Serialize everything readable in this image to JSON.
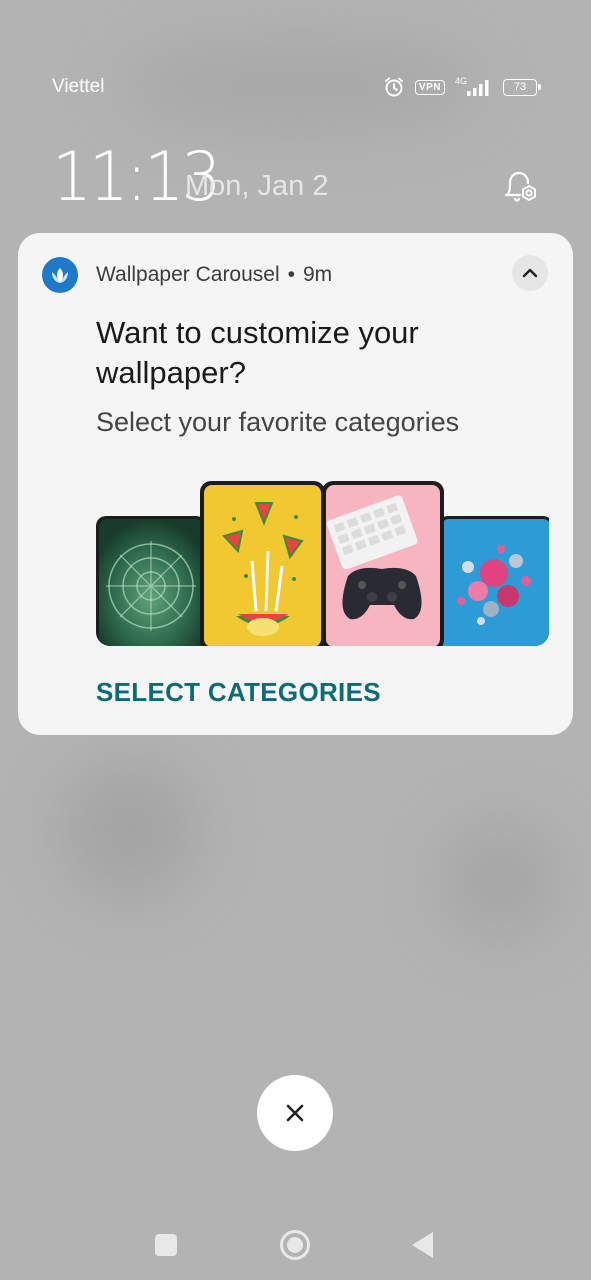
{
  "status_bar": {
    "carrier": "Viettel",
    "vpn_label": "VPN",
    "network_type": "4G",
    "battery_level": "73",
    "icons": [
      "alarm-icon",
      "vpn-icon",
      "signal-icon",
      "battery-icon"
    ]
  },
  "lockscreen": {
    "time": "11:13",
    "date": "Mon, Jan 2"
  },
  "notification": {
    "app_name": "Wallpaper Carousel",
    "separator": "•",
    "age": "9m",
    "title": "Want to customize your wallpaper?",
    "body": "Select your favorite categories",
    "action_label": "SELECT CATEGORIES",
    "accent_color": "#0f6b73",
    "app_icon_color": "#1f79c9",
    "preview_wallpapers": [
      "succulent",
      "watermelon",
      "game-controller",
      "spheres"
    ]
  },
  "dismiss": {
    "icon": "close-icon"
  },
  "navigation": {
    "icons": [
      "recents-icon",
      "home-icon",
      "back-icon"
    ]
  }
}
